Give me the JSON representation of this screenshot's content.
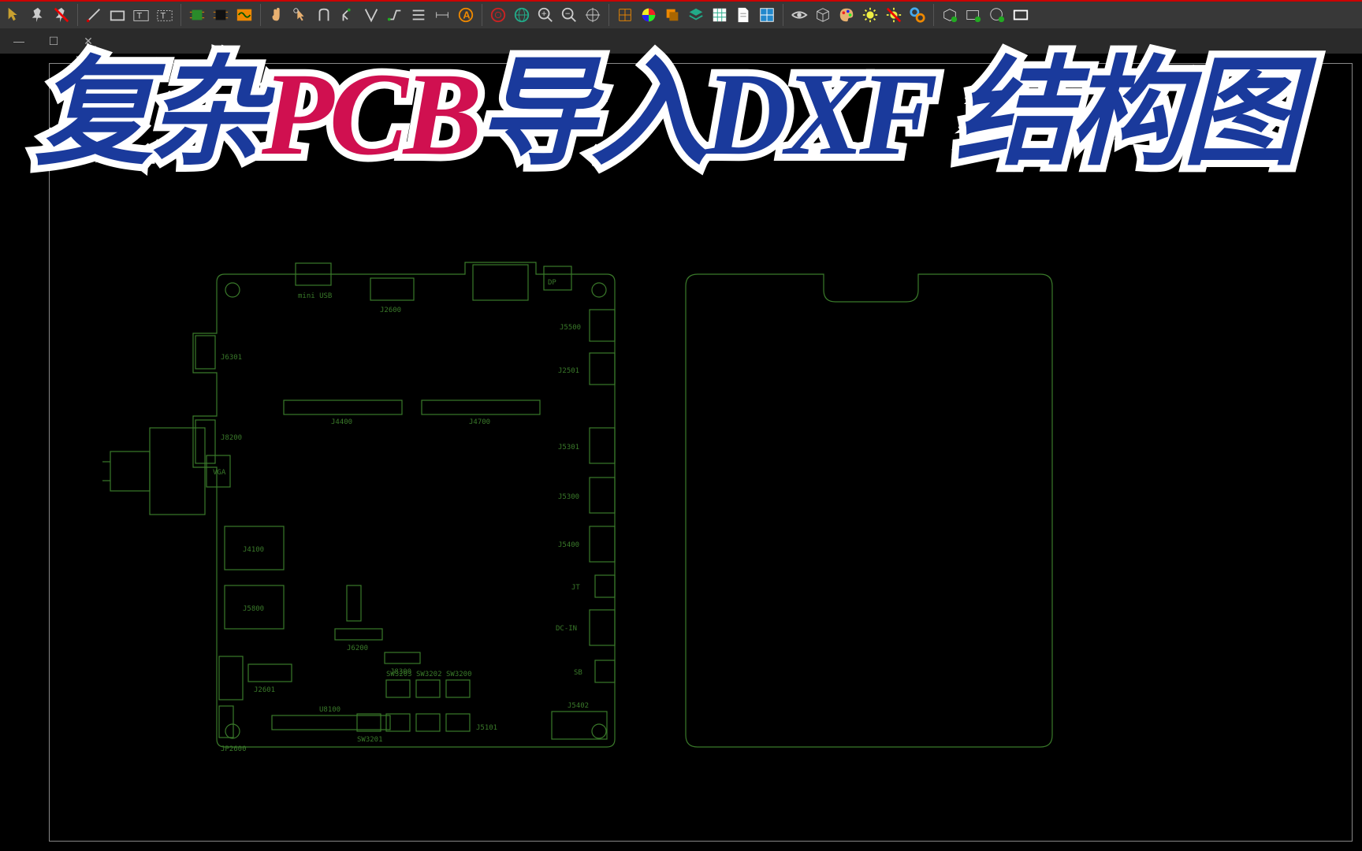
{
  "title": {
    "part1": "复杂",
    "part2": "PCB",
    "part3": "导入DXF",
    "part4": "结构图"
  },
  "components": {
    "j6301": "J6301",
    "j8200": "J8200",
    "j2600": "J2600",
    "j5500": "J5500",
    "j2501": "J2501",
    "j4400": "J4400",
    "j4700": "J4700",
    "j5301": "J5301",
    "j5300": "J5300",
    "j5400": "J5400",
    "j4100": "J4100",
    "vga": "VGA",
    "j5800": "J5800",
    "j6200": "J6200",
    "j8300": "J8300",
    "j2601": "J2601",
    "jp2600": "JP2600",
    "sw3203": "SW3203",
    "sw3202": "SW3202",
    "sw3200": "SW3200",
    "sw3201": "SW3201",
    "u8100": "U8100",
    "j5101": "J5101",
    "j5402": "J5402",
    "dp": "DP",
    "dc_in": "DC-IN",
    "miniusb": "mini USB",
    "jt": "JT",
    "sb": "SB"
  },
  "toolbar_icons": [
    "pointer",
    "pin",
    "unpin",
    "sep",
    "line",
    "rect",
    "text-box",
    "text-outline",
    "sep",
    "chip-green",
    "chip-black",
    "wave",
    "sep",
    "hand",
    "pointer-click",
    "u-turn",
    "branch",
    "v-shape",
    "trace",
    "layers",
    "distance",
    "target-a",
    "sep",
    "circle-target",
    "globe",
    "zoom-fit",
    "zoom-out",
    "crosshair",
    "sep",
    "grid",
    "color-wheel",
    "layer-copy",
    "layer-stack",
    "spreadsheet",
    "document",
    "inspect",
    "sep",
    "eye",
    "cube",
    "palette",
    "brightness",
    "brightness-off",
    "link",
    "sep",
    "shape-add",
    "rect-add",
    "circle-add",
    "rect-white"
  ]
}
